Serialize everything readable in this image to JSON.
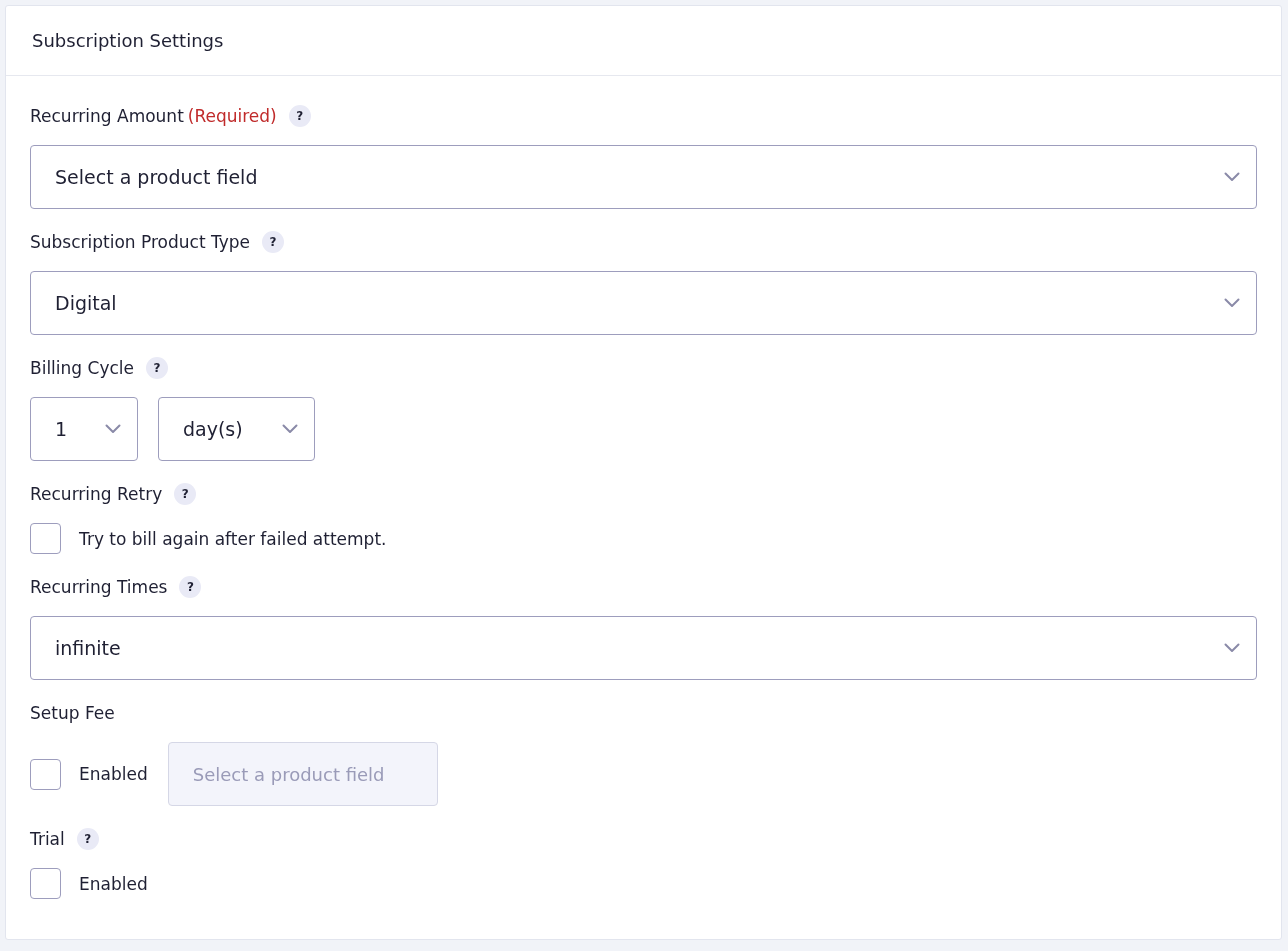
{
  "panel": {
    "title": "Subscription Settings"
  },
  "fields": [
    {
      "kind": "select",
      "label": "Recurring Amount",
      "required": "(Required)",
      "help": "?",
      "value": "Select a product field"
    },
    {
      "kind": "select",
      "label": "Subscription Product Type",
      "help": "?",
      "value": "Digital"
    },
    {
      "kind": "cycle",
      "label": "Billing Cycle",
      "help": "?",
      "selects": [
        "1",
        "day(s)"
      ]
    },
    {
      "kind": "checkbox",
      "label": "Recurring Retry",
      "help": "?",
      "checked": false,
      "option": "Try to bill again after failed attempt."
    },
    {
      "kind": "select",
      "label": "Recurring Times",
      "help": "?",
      "value": "infinite"
    },
    {
      "kind": "checkbox_field",
      "label": "Setup Fee",
      "checked": false,
      "option": "Enabled",
      "field": {
        "placeholder": "Select a product field",
        "disabled": true
      }
    },
    {
      "kind": "checkbox",
      "label": "Trial",
      "help": "?",
      "checked": false,
      "option": "Enabled"
    }
  ]
}
